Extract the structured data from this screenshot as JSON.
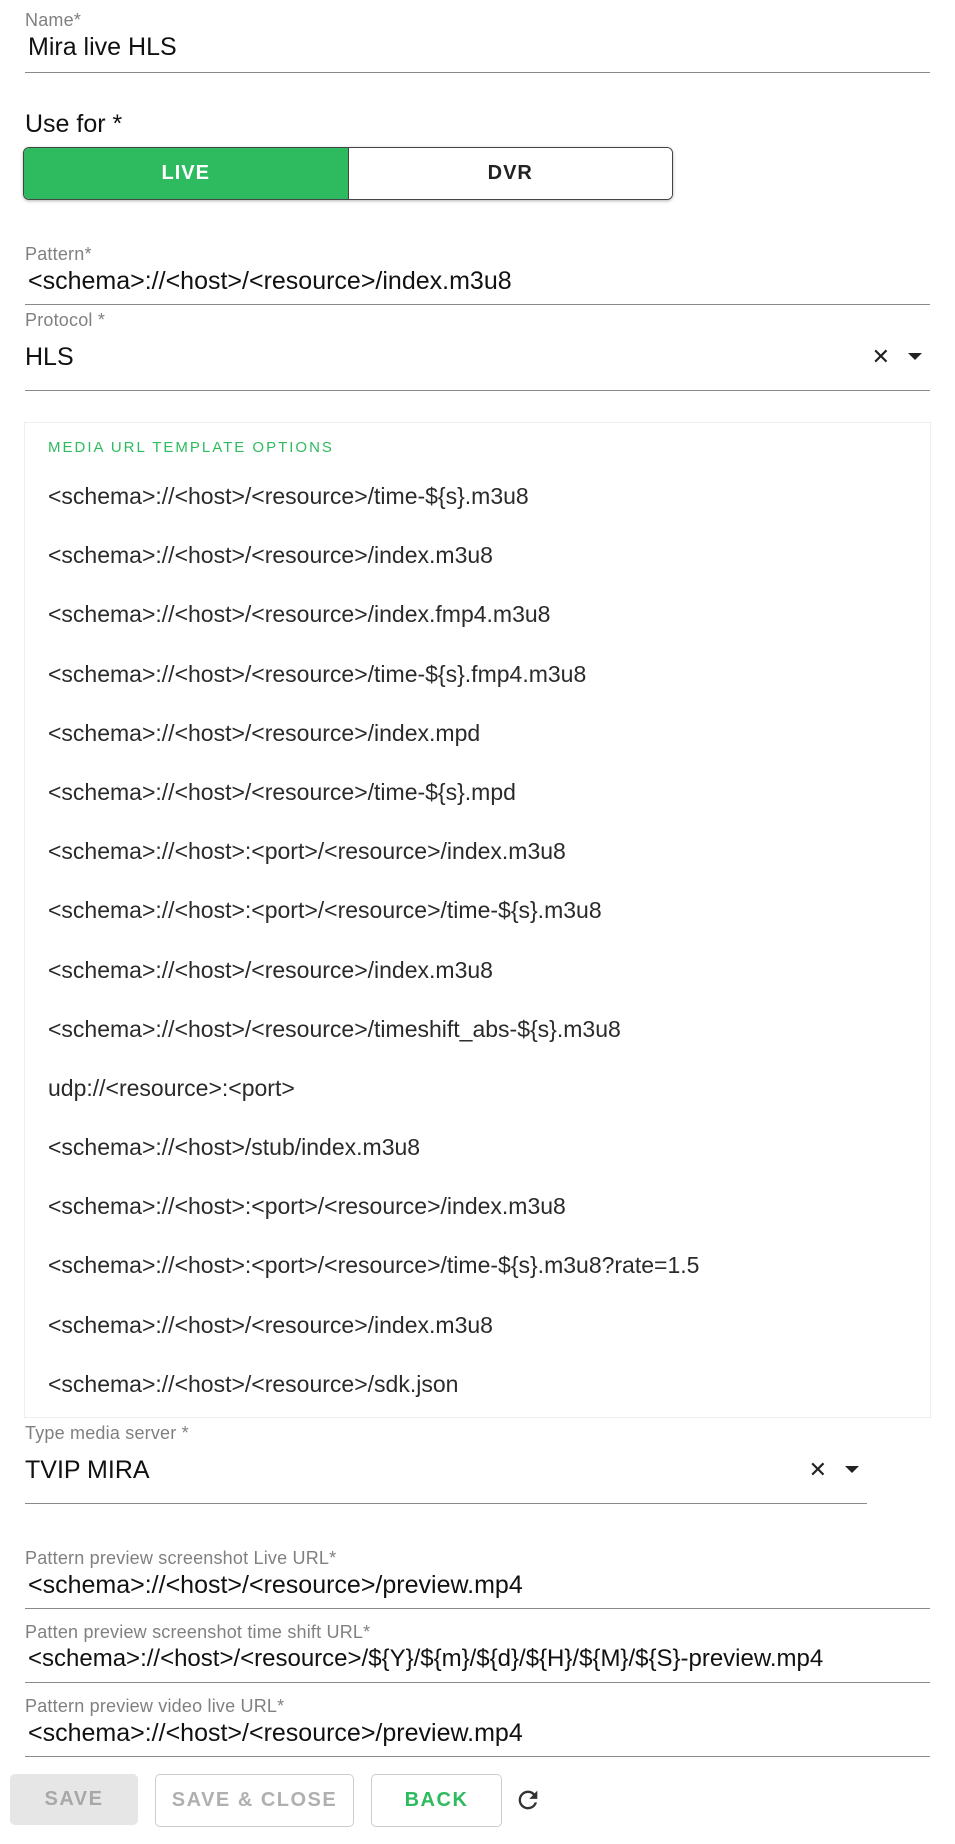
{
  "name": {
    "label": "Name",
    "required": "*",
    "value": "Mira live HLS"
  },
  "use_for": {
    "label": "Use for *",
    "options": [
      "LIVE",
      "DVR"
    ],
    "selected": "LIVE"
  },
  "pattern": {
    "label": "Pattern",
    "required": "*",
    "value": "<schema>://<host>/<resource>/index.m3u8"
  },
  "protocol": {
    "label": "Protocol *",
    "value": "HLS",
    "clear_icon": "close-icon",
    "dropdown_icon": "chevron-down-icon"
  },
  "dropdown": {
    "header": "MEDIA URL TEMPLATE OPTIONS",
    "options": [
      "<schema>://<host>/<resource>/time-${s}.m3u8",
      "<schema>://<host>/<resource>/index.m3u8",
      "<schema>://<host>/<resource>/index.fmp4.m3u8",
      "<schema>://<host>/<resource>/time-${s}.fmp4.m3u8",
      "<schema>://<host>/<resource>/index.mpd",
      "<schema>://<host>/<resource>/time-${s}.mpd",
      "<schema>://<host>:<port>/<resource>/index.m3u8",
      "<schema>://<host>:<port>/<resource>/time-${s}.m3u8",
      "<schema>://<host>/<resource>/index.m3u8",
      "<schema>://<host>/<resource>/timeshift_abs-${s}.m3u8",
      "udp://<resource>:<port>",
      "<schema>://<host>/stub/index.m3u8",
      "<schema>://<host>:<port>/<resource>/index.m3u8",
      "<schema>://<host>:<port>/<resource>/time-${s}.m3u8?rate=1.5",
      "<schema>://<host>/<resource>/index.m3u8",
      "<schema>://<host>/<resource>/sdk.json"
    ]
  },
  "media_server": {
    "label": "Type media server *",
    "value": "TVIP MIRA"
  },
  "preview_live": {
    "label": "Pattern preview screenshot Live URL",
    "required": "*",
    "value": "<schema>://<host>/<resource>/preview.mp4"
  },
  "preview_shift": {
    "label": "Patten preview screenshot time shift URL",
    "required": "*",
    "value": "<schema>://<host>/<resource>/${Y}/${m}/${d}/${H}/${M}/${S}-preview.mp4"
  },
  "video_live": {
    "label": "Pattern preview video live URL",
    "required": "*",
    "value": "<schema>://<host>/<resource>/preview.mp4"
  },
  "buttons": {
    "save": "SAVE",
    "save_close": "SAVE & CLOSE",
    "back": "BACK",
    "refresh_icon": "refresh-icon"
  },
  "colors": {
    "accent": "#2ebb5f",
    "disabled": "#e6e6e6"
  }
}
